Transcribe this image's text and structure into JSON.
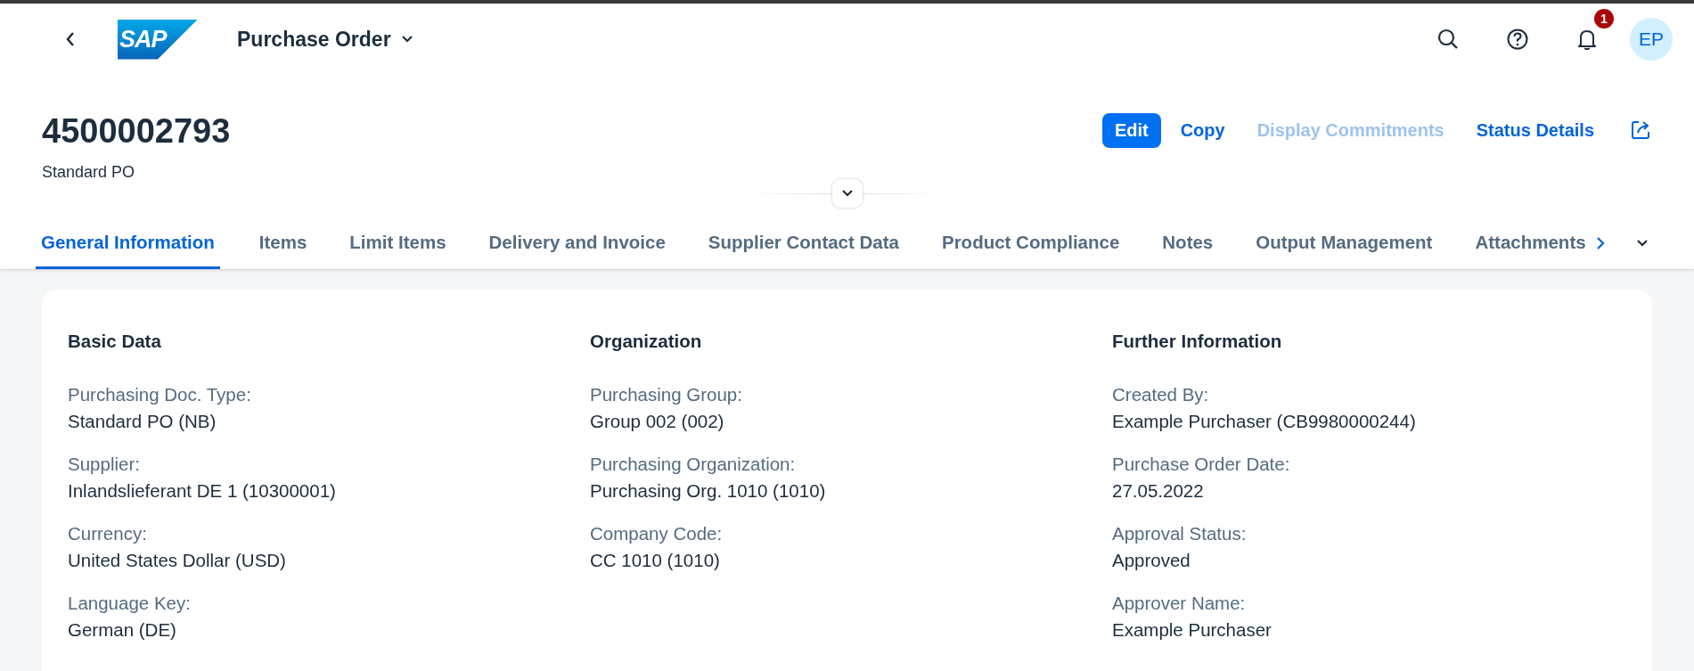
{
  "shell": {
    "logo": "SAP",
    "app_title": "Purchase Order",
    "notifications": "1",
    "avatar": "EP"
  },
  "header": {
    "title": "4500002793",
    "subtitle": "Standard PO",
    "actions": [
      {
        "label": "Edit",
        "kind": "emphasized",
        "disabled": false
      },
      {
        "label": "Copy",
        "kind": "transparent",
        "disabled": false
      },
      {
        "label": "Display Commitments",
        "kind": "transparent",
        "disabled": true
      },
      {
        "label": "Status Details",
        "kind": "transparent",
        "disabled": false
      }
    ]
  },
  "tabs": [
    {
      "label": "General Information",
      "selected": true
    },
    {
      "label": "Items",
      "selected": false
    },
    {
      "label": "Limit Items",
      "selected": false
    },
    {
      "label": "Delivery and Invoice",
      "selected": false
    },
    {
      "label": "Supplier Contact Data",
      "selected": false
    },
    {
      "label": "Product Compliance",
      "selected": false
    },
    {
      "label": "Notes",
      "selected": false
    },
    {
      "label": "Output Management",
      "selected": false
    },
    {
      "label": "Attachments",
      "selected": false
    }
  ],
  "sections": [
    {
      "title": "Basic Data",
      "fields": [
        {
          "label": "Purchasing Doc. Type:",
          "value": "Standard PO (NB)"
        },
        {
          "label": "Supplier:",
          "value": "Inlandslieferant DE 1 (10300001)"
        },
        {
          "label": "Currency:",
          "value": "United States Dollar (USD)"
        },
        {
          "label": "Language Key:",
          "value": "German (DE)"
        }
      ]
    },
    {
      "title": "Organization",
      "fields": [
        {
          "label": "Purchasing Group:",
          "value": "Group 002 (002)"
        },
        {
          "label": "Purchasing Organization:",
          "value": "Purchasing Org. 1010 (1010)"
        },
        {
          "label": "Company Code:",
          "value": "CC 1010 (1010)"
        }
      ]
    },
    {
      "title": "Further Information",
      "fields": [
        {
          "label": "Created By:",
          "value": "Example Purchaser (CB9980000244)"
        },
        {
          "label": "Purchase Order Date:",
          "value": "27.05.2022"
        },
        {
          "label": "Approval Status:",
          "value": "Approved"
        },
        {
          "label": "Approver Name:",
          "value": "Example Purchaser"
        }
      ]
    }
  ]
}
